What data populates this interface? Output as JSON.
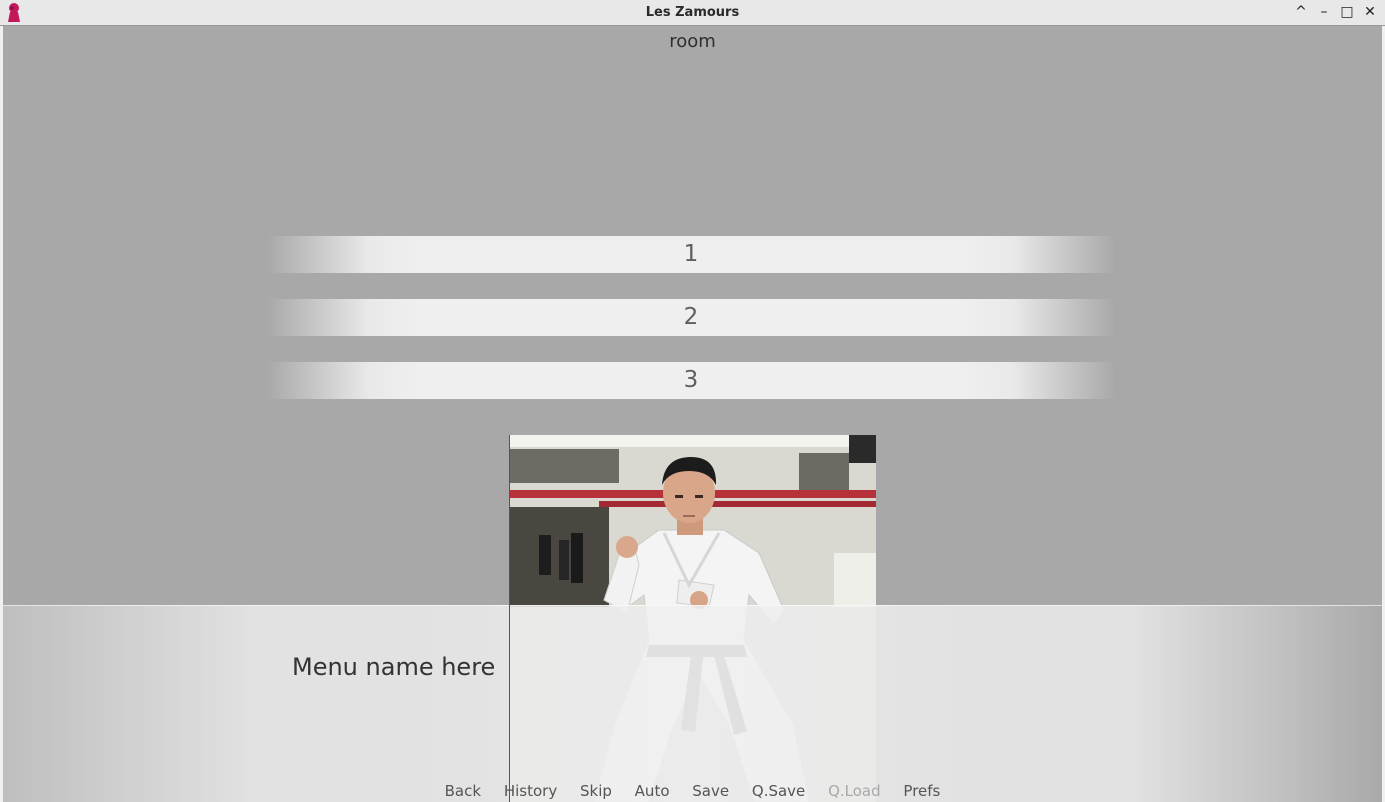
{
  "window": {
    "title": "Les Zamours",
    "icon": "app-icon",
    "controls": {
      "shade": "^",
      "minimize": "–",
      "maximize": "□",
      "close": "✕"
    }
  },
  "scene": {
    "location": "room",
    "choices": [
      "1",
      "2",
      "3"
    ]
  },
  "dialogue": {
    "speaker": "Menu name here"
  },
  "quick_menu": {
    "back": "Back",
    "history": "History",
    "skip": "Skip",
    "auto": "Auto",
    "save": "Save",
    "qsave": "Q.Save",
    "qload": "Q.Load",
    "prefs": "Prefs"
  },
  "colors": {
    "background": "#a8a8a8",
    "choice_bg": "#efefef",
    "disabled_text": "#a9a9a9",
    "icon_accent": "#c2185b"
  }
}
